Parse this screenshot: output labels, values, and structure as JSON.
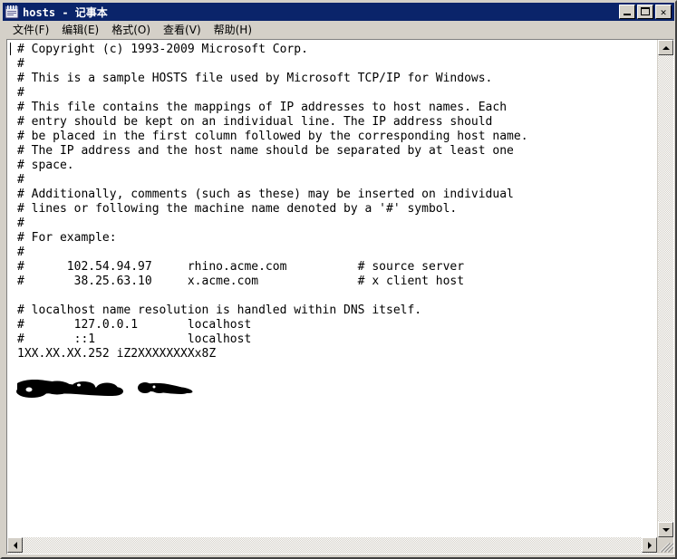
{
  "window": {
    "title": "hosts - 记事本",
    "icon": "notepad-icon",
    "titlebar_color": "#0a246a",
    "face_color": "#d4d0c8"
  },
  "titlebar_buttons": {
    "minimize_label": "_",
    "maximize_label": "□",
    "close_label": "✕"
  },
  "menu": {
    "items": [
      {
        "label": "文件(F)",
        "name": "menu-file"
      },
      {
        "label": "编辑(E)",
        "name": "menu-edit"
      },
      {
        "label": "格式(O)",
        "name": "menu-format"
      },
      {
        "label": "查看(V)",
        "name": "menu-view"
      },
      {
        "label": "帮助(H)",
        "name": "menu-help"
      }
    ]
  },
  "editor": {
    "content_lines": [
      "# Copyright (c) 1993-2009 Microsoft Corp.",
      "#",
      "# This is a sample HOSTS file used by Microsoft TCP/IP for Windows.",
      "#",
      "# This file contains the mappings of IP addresses to host names. Each",
      "# entry should be kept on an individual line. The IP address should",
      "# be placed in the first column followed by the corresponding host name.",
      "# The IP address and the host name should be separated by at least one",
      "# space.",
      "#",
      "# Additionally, comments (such as these) may be inserted on individual",
      "# lines or following the machine name denoted by a '#' symbol.",
      "#",
      "# For example:",
      "#",
      "#      102.54.94.97     rhino.acme.com          # source server",
      "#       38.25.63.10     x.acme.com              # x client host",
      "",
      "# localhost name resolution is handled within DNS itself.",
      "#       127.0.0.1       localhost",
      "#       ::1             localhost",
      "1XX.XX.XX.252 iZ2XXXXXXXXx8Z"
    ],
    "redacted_line_index": 21,
    "redacted_visible_fragments": [
      ".252",
      "iZ2",
      "x8Z"
    ],
    "text_color": "#000000",
    "background_color": "#ffffff"
  },
  "scrollbars": {
    "vertical": {
      "up_arrow": "▲",
      "down_arrow": "▼"
    },
    "horizontal": {
      "left_arrow": "◄",
      "right_arrow": "►"
    },
    "resize_grip": "resize-grip"
  }
}
